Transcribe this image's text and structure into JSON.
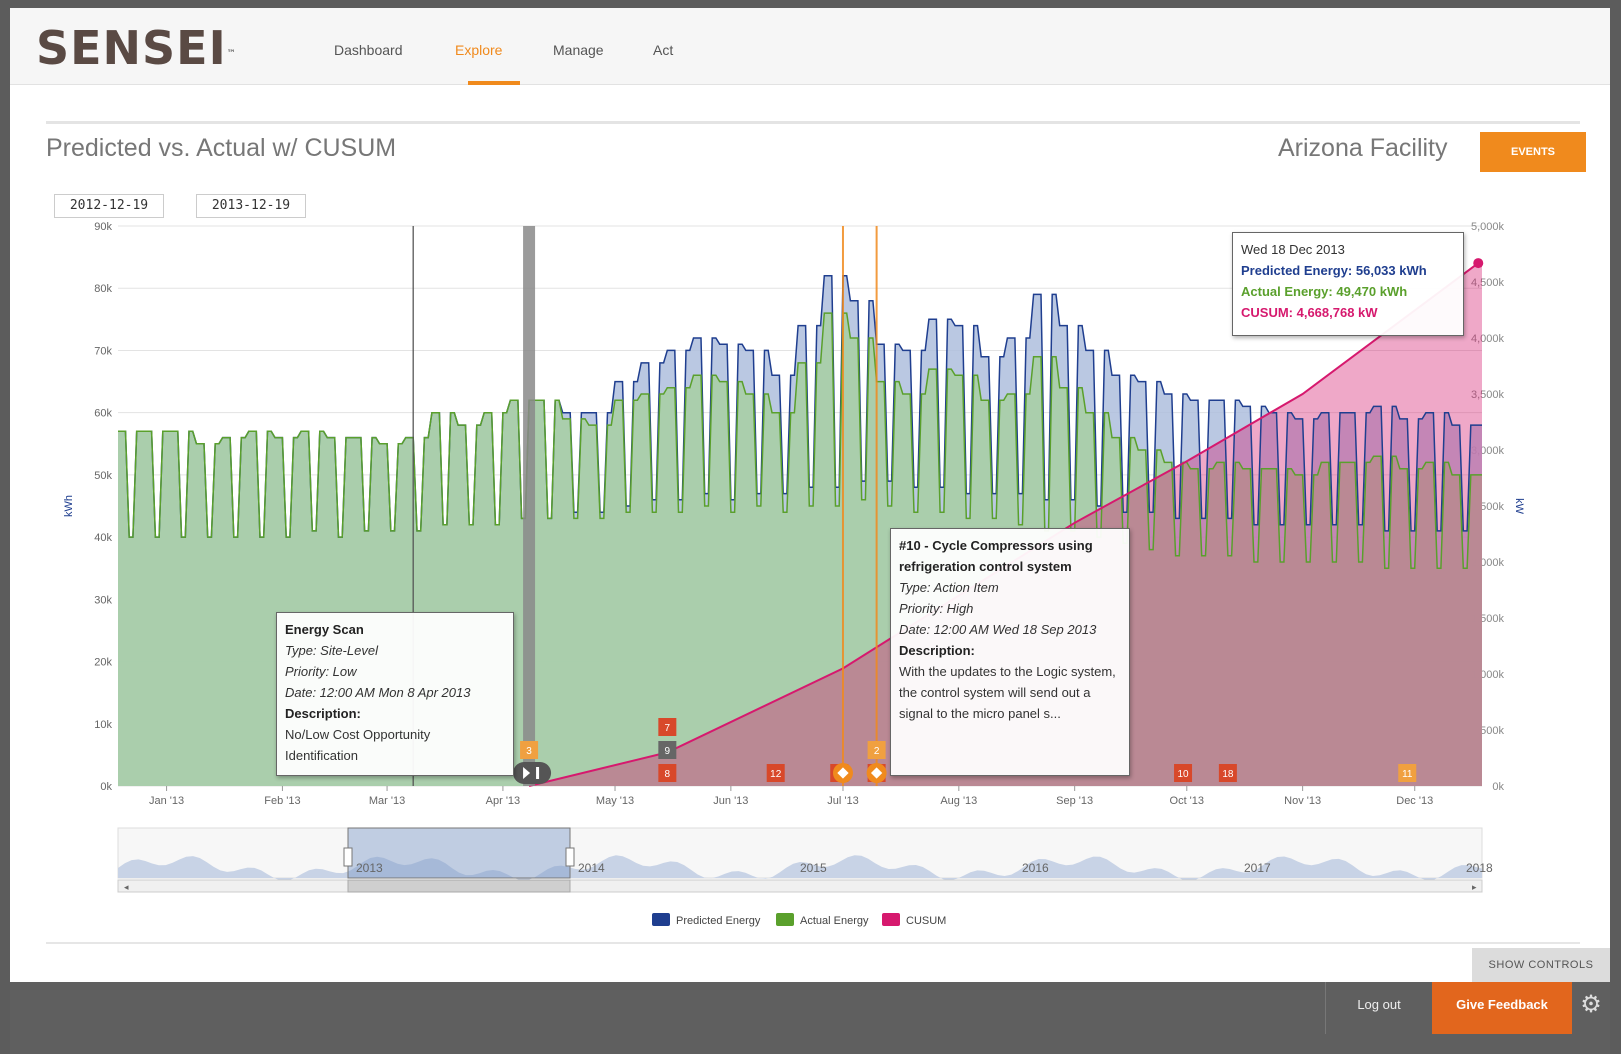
{
  "app": {
    "logo": "SENSEI",
    "logo_tm": "™"
  },
  "nav": {
    "items": [
      "Dashboard",
      "Explore",
      "Manage",
      "Act"
    ],
    "active": "Explore"
  },
  "header": {
    "title": "Predicted vs. Actual w/ CUSUM",
    "facility": "Arizona Facility",
    "events_button": "EVENTS"
  },
  "date_range": {
    "start": "2012-12-19",
    "end": "2013-12-19"
  },
  "colors": {
    "predicted": "#1f3e8f",
    "actual": "#5aa02c",
    "cusum": "#d6196e",
    "accent": "#f08a1d"
  },
  "chart_data": {
    "type": "area",
    "x_tick_labels": [
      "Jan '13",
      "Feb '13",
      "Mar '13",
      "Apr '13",
      "May '13",
      "Jun '13",
      "Jul '13",
      "Aug '13",
      "Sep '13",
      "Oct '13",
      "Nov '13",
      "Dec '13"
    ],
    "y_left": {
      "label": "kWh",
      "ticks": [
        "0k",
        "10k",
        "20k",
        "30k",
        "40k",
        "50k",
        "60k",
        "70k",
        "80k",
        "90k"
      ],
      "range": [
        0,
        90000
      ]
    },
    "y_right": {
      "label": "kW",
      "ticks": [
        "0k",
        "500k",
        "1,000k",
        "1,500k",
        "2,000k",
        "2,500k",
        "3,000k",
        "3,500k",
        "4,000k",
        "4,500k",
        "5,000k"
      ],
      "range": [
        0,
        5000000
      ]
    },
    "x_range": [
      "2012-12-19",
      "2013-12-19"
    ],
    "series": [
      {
        "name": "Predicted Energy",
        "weekly_high_kwh": [
          57,
          57,
          57,
          55,
          56,
          57,
          56,
          57,
          56,
          56,
          55,
          56,
          60,
          58,
          60,
          62,
          62,
          60,
          60,
          65,
          68,
          70,
          72,
          71,
          70,
          66,
          74,
          82,
          78,
          71,
          70,
          75,
          74,
          69,
          72,
          79,
          74,
          70,
          66,
          65,
          63,
          62,
          62,
          61,
          60,
          59,
          60,
          60,
          61,
          59,
          60,
          58
        ],
        "weekly_low_kwh": [
          40,
          40,
          40,
          40,
          40,
          40,
          40,
          41,
          40,
          41,
          41,
          41,
          42,
          42,
          42,
          43,
          43,
          44,
          44,
          45,
          46,
          46,
          47,
          46,
          47,
          47,
          48,
          48,
          49,
          49,
          48,
          48,
          47,
          47,
          47,
          46,
          46,
          45,
          44,
          44,
          43,
          43,
          43,
          42,
          42,
          42,
          42,
          42,
          41,
          41,
          41,
          41
        ],
        "unit": "thousand kWh"
      },
      {
        "name": "Actual Energy",
        "weekly_high_kwh": [
          57,
          57,
          57,
          55,
          56,
          57,
          56,
          57,
          56,
          56,
          55,
          56,
          60,
          58,
          60,
          62,
          62,
          59,
          58,
          62,
          63,
          64,
          66,
          65,
          63,
          60,
          68,
          76,
          72,
          65,
          63,
          67,
          66,
          62,
          63,
          69,
          64,
          60,
          56,
          54,
          52,
          51,
          52,
          51,
          51,
          50,
          52,
          52,
          53,
          51,
          52,
          50
        ],
        "weekly_low_kwh": [
          40,
          40,
          40,
          40,
          40,
          40,
          40,
          41,
          40,
          41,
          41,
          41,
          42,
          42,
          42,
          43,
          43,
          43,
          43,
          44,
          44,
          44,
          45,
          44,
          45,
          44,
          45,
          45,
          46,
          45,
          44,
          44,
          43,
          43,
          42,
          41,
          41,
          40,
          39,
          38,
          37,
          37,
          37,
          36,
          36,
          36,
          36,
          36,
          35,
          35,
          35,
          35
        ],
        "unit": "thousand kWh"
      },
      {
        "name": "CUSUM",
        "points": [
          [
            "2013-04-08",
            0
          ],
          [
            "2013-05-15",
            300
          ],
          [
            "2013-07-01",
            1050
          ],
          [
            "2013-08-01",
            1700
          ],
          [
            "2013-09-01",
            2350
          ],
          [
            "2013-10-01",
            2900
          ],
          [
            "2013-11-01",
            3500
          ],
          [
            "2013-12-18",
            4669
          ]
        ],
        "unit": "thousand kW"
      }
    ],
    "legend": [
      "Predicted Energy",
      "Actual Energy",
      "CUSUM"
    ],
    "legend_position": "bottom"
  },
  "markers": [
    {
      "label": "3",
      "color": "#f0a040"
    },
    {
      "label": "7",
      "color": "#d8482a"
    },
    {
      "label": "9",
      "color": "#666666"
    },
    {
      "label": "8",
      "color": "#d8482a"
    },
    {
      "label": "12",
      "color": "#d8482a"
    },
    {
      "label": "13",
      "color": "#d8482a"
    },
    {
      "label": "2",
      "color": "#f0a040"
    },
    {
      "label": "16",
      "color": "#d8482a"
    },
    {
      "label": "10",
      "color": "#d8482a"
    },
    {
      "label": "18",
      "color": "#d8482a"
    },
    {
      "label": "11",
      "color": "#f0a040"
    }
  ],
  "navigator": {
    "year_labels": [
      "2013",
      "2014",
      "2015",
      "2016",
      "2017",
      "2018"
    ]
  },
  "tooltip_point": {
    "date": "Wed 18 Dec 2013",
    "predicted": "Predicted Energy: 56,033 kWh",
    "actual": "Actual Energy: 49,470 kWh",
    "cusum": "CUSUM: 4,668,768 kW"
  },
  "tooltip_energy_scan": {
    "title": "Energy Scan",
    "type": "Type: Site-Level",
    "priority": "Priority: Low",
    "date": "Date: 12:00 AM Mon 8 Apr 2013",
    "desc_label": "Description:",
    "desc": "No/Low Cost Opportunity Identification"
  },
  "tooltip_cycle": {
    "title": "#10 - Cycle Compressors using refrigeration control system",
    "type": "Type: Action Item",
    "priority": "Priority: High",
    "date": "Date: 12:00 AM Wed 18 Sep 2013",
    "desc_label": "Description:",
    "desc": "With the updates to the Logic system, the control system will send out a signal to the micro panel s..."
  },
  "footer": {
    "show_controls": "SHOW CONTROLS",
    "logout": "Log out",
    "feedback": "Give Feedback"
  }
}
